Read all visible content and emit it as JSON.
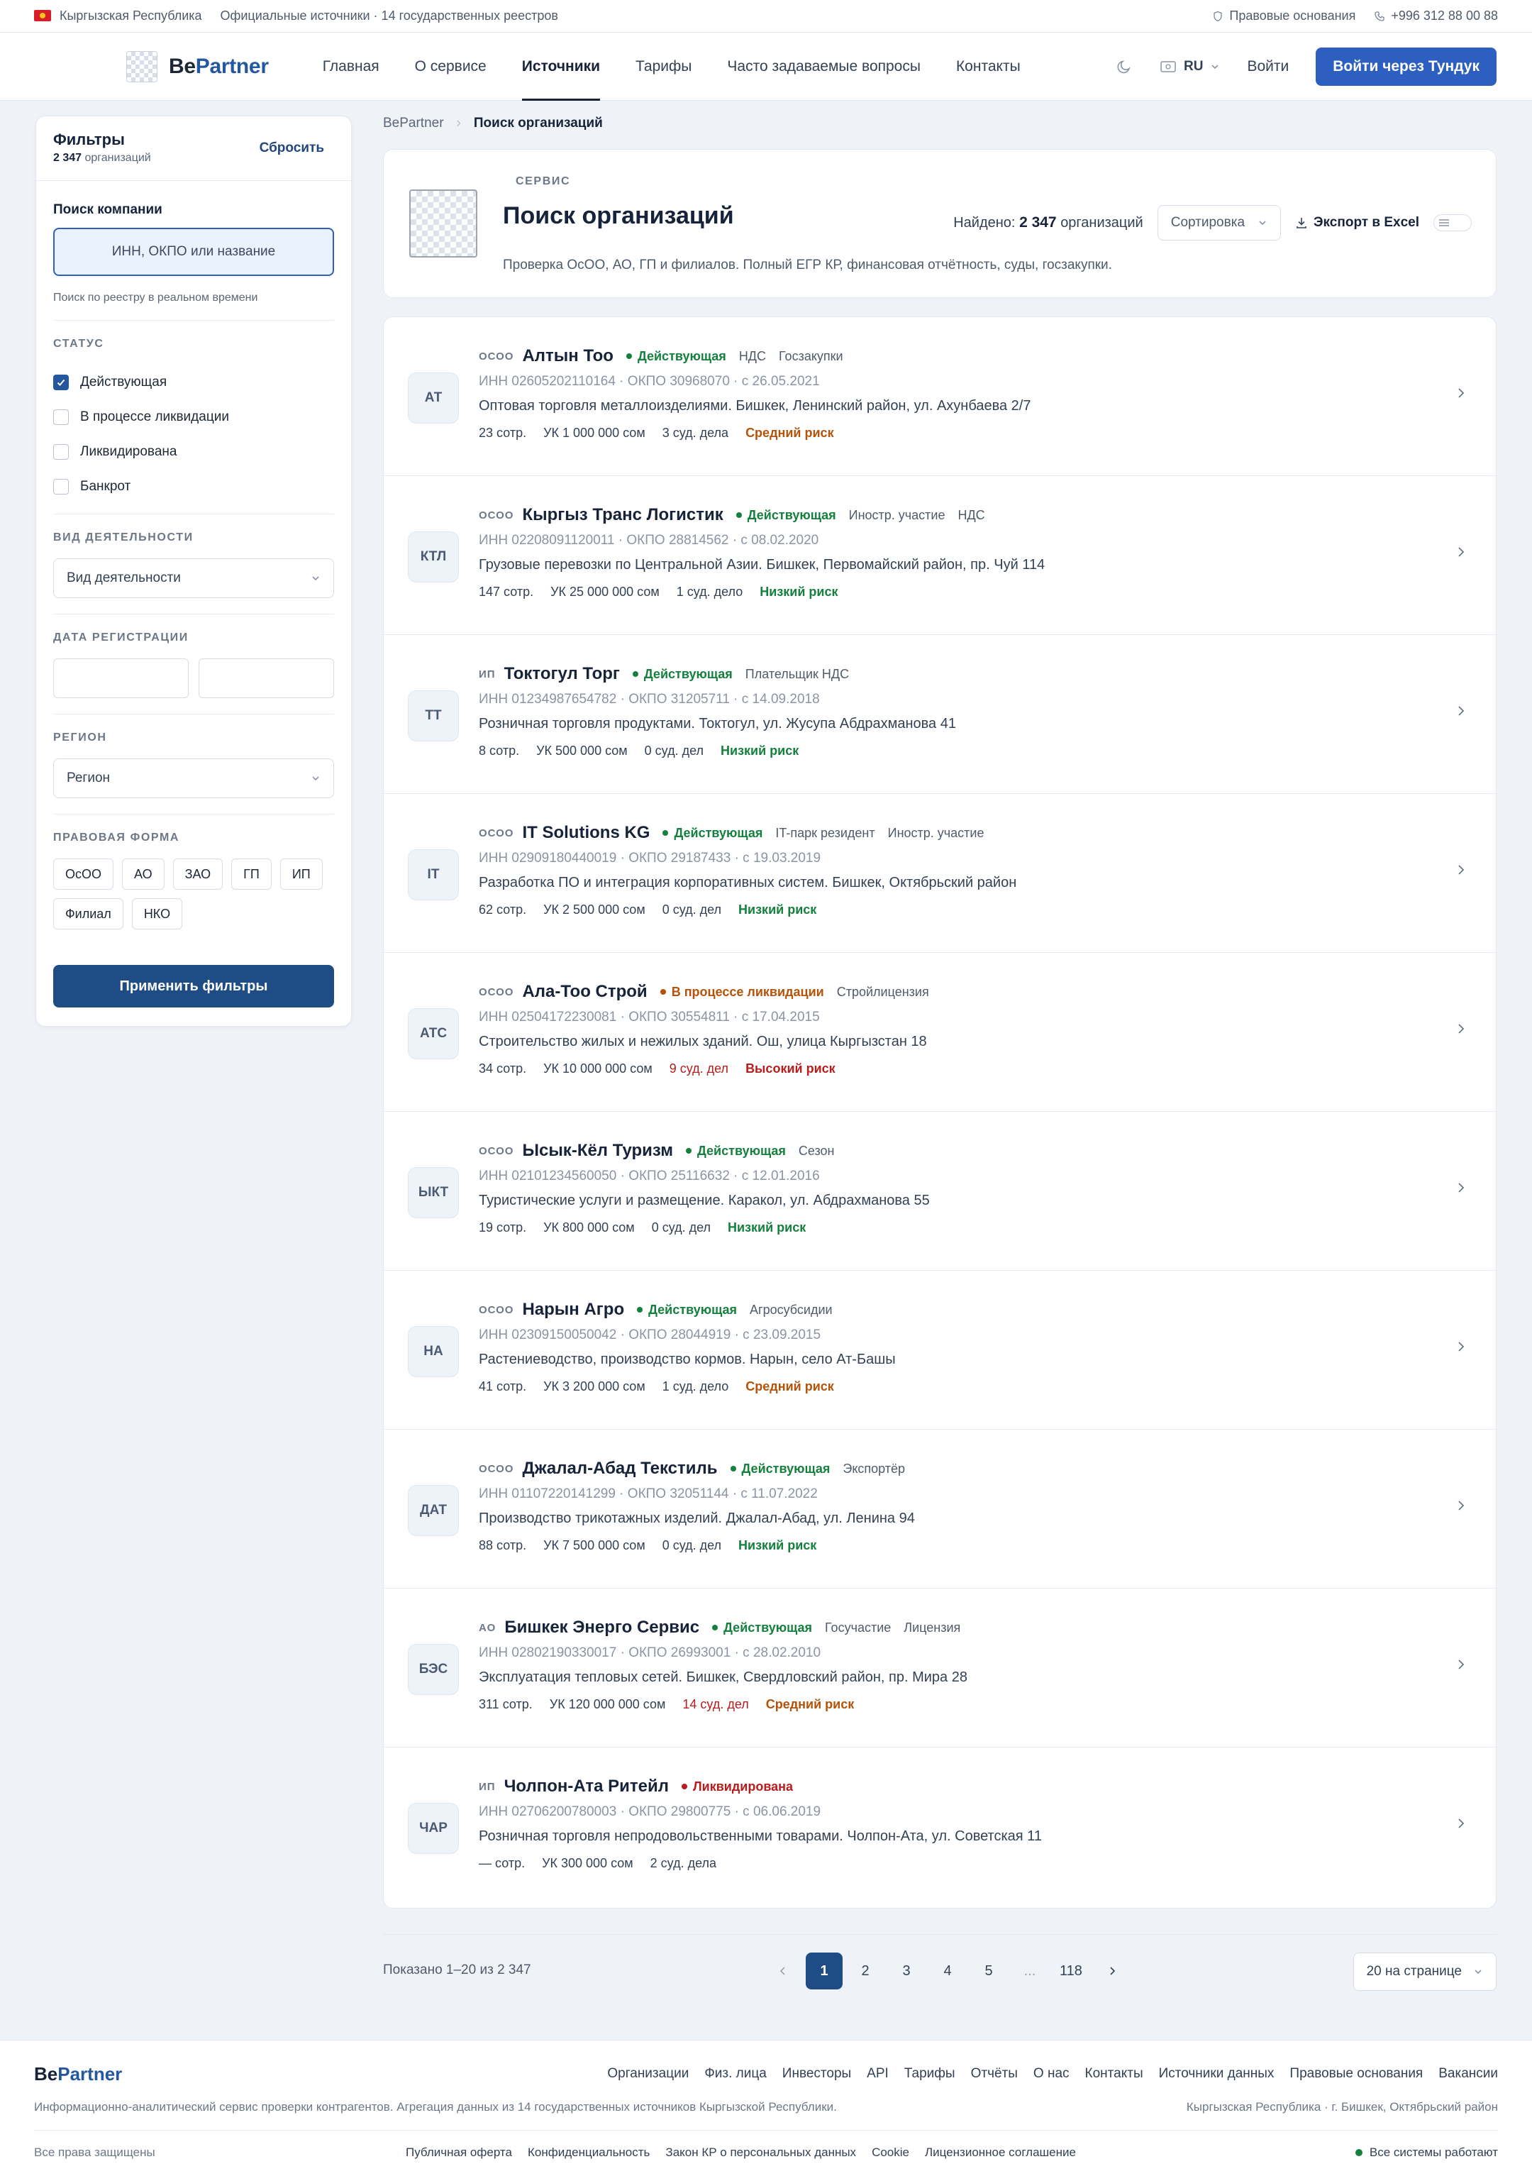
{
  "topbar": {
    "country": "Кыргызская Республика",
    "sources": "Официальные источники · 14 государственных реестров",
    "legal": "Правовые основания",
    "phone": "+996 312 88 00 88"
  },
  "header": {
    "logo_prefix": "Be",
    "logo_suffix": "Partner",
    "nav": [
      "Главная",
      "О сервисе",
      "Источники",
      "Тарифы",
      "Часто задаваемые вопросы",
      "Контакты"
    ],
    "active_nav": "Источники",
    "lang": "RU",
    "login": "Войти",
    "cta": "Войти через Тундук"
  },
  "sidebar": {
    "title": "Фильтры",
    "count": "2 347",
    "count_label": "организаций",
    "reset": "Сбросить",
    "search_label": "Поиск компании",
    "search_placeholder": "ИНН, ОКПО или название",
    "search_hint": "Поиск по реестру в реальном времени",
    "status_title": "СТАТУС",
    "statuses": [
      {
        "label": "Действующая",
        "checked": true
      },
      {
        "label": "В процессе ликвидации",
        "checked": false
      },
      {
        "label": "Ликвидирована",
        "checked": false
      },
      {
        "label": "Банкрот",
        "checked": false
      }
    ],
    "activity_title": "ВИД ДЕЯТЕЛЬНОСТИ",
    "activity_placeholder": "Вид деятельности",
    "date_title": "ДАТА РЕГИСТРАЦИИ",
    "region_title": "РЕГИОН",
    "region_placeholder": "Регион",
    "legal_title": "ПРАВОВАЯ ФОРМА",
    "legal_forms": [
      "ОсОО",
      "АО",
      "ЗАО",
      "ГП",
      "ИП",
      "Филиал",
      "НКО"
    ],
    "apply": "Применить фильтры"
  },
  "breadcrumb": {
    "root": "BePartner",
    "current": "Поиск организаций"
  },
  "hero": {
    "kicker": "СЕРВИС",
    "title": "Поиск организаций",
    "description": "Проверка ОсОО, АО, ГП и филиалов. Полный ЕГР КР, финансовая отчётность, суды, госзакупки.",
    "found_label": "Найдено:",
    "found_count": "2 347",
    "found_suffix": "организаций",
    "sort": "Сортировка",
    "export": "Экспорт в Excel"
  },
  "results": [
    {
      "initials": "АТ",
      "form": "ОСОО",
      "name": "Алтын Тоо",
      "status": "Действующая",
      "status_color": "#15803d",
      "tags": [
        "НДС",
        "Госзакупки"
      ],
      "meta": "ИНН 02605202110164 · ОКПО 30968070 · с 26.05.2021",
      "desc": "Оптовая торговля металлоизделиями. Бишкек, Ленинский район, ул. Ахунбаева 2/7",
      "employees": "23 сотр.",
      "capital": "УК 1 000 000 сом",
      "cases": "3 суд. дела",
      "cases_color": "#334155",
      "risk": "Средний риск",
      "risk_color": "#b45309"
    },
    {
      "initials": "КТЛ",
      "form": "ОСОО",
      "name": "Кыргыз Транс Логистик",
      "status": "Действующая",
      "status_color": "#15803d",
      "tags": [
        "Иностр. участие",
        "НДС"
      ],
      "meta": "ИНН 02208091120011 · ОКПО 28814562 · с 08.02.2020",
      "desc": "Грузовые перевозки по Центральной Азии. Бишкек, Первомайский район, пр. Чуй 114",
      "employees": "147 сотр.",
      "capital": "УК 25 000 000 сом",
      "cases": "1 суд. дело",
      "cases_color": "#334155",
      "risk": "Низкий риск",
      "risk_color": "#15803d"
    },
    {
      "initials": "ТТ",
      "form": "ИП",
      "name": "Токтогул Торг",
      "status": "Действующая",
      "status_color": "#15803d",
      "tags": [
        "Плательщик НДС"
      ],
      "meta": "ИНН 01234987654782 · ОКПО 31205711 · с 14.09.2018",
      "desc": "Розничная торговля продуктами. Токтогул, ул. Жусупа Абдрахманова 41",
      "employees": "8 сотр.",
      "capital": "УК 500 000 сом",
      "cases": "0 суд. дел",
      "cases_color": "#334155",
      "risk": "Низкий риск",
      "risk_color": "#15803d"
    },
    {
      "initials": "IT",
      "form": "ОСОО",
      "name": "IT Solutions KG",
      "status": "Действующая",
      "status_color": "#15803d",
      "tags": [
        "IT-парк резидент",
        "Иностр. участие"
      ],
      "meta": "ИНН 02909180440019 · ОКПО 29187433 · с 19.03.2019",
      "desc": "Разработка ПО и интеграция корпоративных систем. Бишкек, Октябрьский район",
      "employees": "62 сотр.",
      "capital": "УК 2 500 000 сом",
      "cases": "0 суд. дел",
      "cases_color": "#334155",
      "risk": "Низкий риск",
      "risk_color": "#15803d"
    },
    {
      "initials": "АТС",
      "form": "ОСОО",
      "name": "Ала-Тоо Строй",
      "status": "В процессе ликвидации",
      "status_color": "#b45309",
      "tags": [
        "Стройлицензия"
      ],
      "meta": "ИНН 02504172230081 · ОКПО 30554811 · с 17.04.2015",
      "desc": "Строительство жилых и нежилых зданий. Ош, улица Кыргызстан 18",
      "employees": "34 сотр.",
      "capital": "УК 10 000 000 сом",
      "cases": "9 суд. дел",
      "cases_color": "#b91c1c",
      "risk": "Высокий риск",
      "risk_color": "#b91c1c"
    },
    {
      "initials": "ЫКТ",
      "form": "ОСОО",
      "name": "Ысык-Кёл Туризм",
      "status": "Действующая",
      "status_color": "#15803d",
      "tags": [
        "Сезон"
      ],
      "meta": "ИНН 02101234560050 · ОКПО 25116632 · с 12.01.2016",
      "desc": "Туристические услуги и размещение. Каракол, ул. Абдрахманова 55",
      "employees": "19 сотр.",
      "capital": "УК 800 000 сом",
      "cases": "0 суд. дел",
      "cases_color": "#334155",
      "risk": "Низкий риск",
      "risk_color": "#15803d"
    },
    {
      "initials": "НА",
      "form": "ОСОО",
      "name": "Нарын Агро",
      "status": "Действующая",
      "status_color": "#15803d",
      "tags": [
        "Агросубсидии"
      ],
      "meta": "ИНН 02309150050042 · ОКПО 28044919 · с 23.09.2015",
      "desc": "Растениеводство, производство кормов. Нарын, село Ат-Башы",
      "employees": "41 сотр.",
      "capital": "УК 3 200 000 сом",
      "cases": "1 суд. дело",
      "cases_color": "#334155",
      "risk": "Средний риск",
      "risk_color": "#b45309"
    },
    {
      "initials": "ДАТ",
      "form": "ОСОО",
      "name": "Джалал-Абад Текстиль",
      "status": "Действующая",
      "status_color": "#15803d",
      "tags": [
        "Экспортёр"
      ],
      "meta": "ИНН 01107220141299 · ОКПО 32051144 · с 11.07.2022",
      "desc": "Производство трикотажных изделий. Джалал-Абад, ул. Ленина 94",
      "employees": "88 сотр.",
      "capital": "УК 7 500 000 сом",
      "cases": "0 суд. дел",
      "cases_color": "#334155",
      "risk": "Низкий риск",
      "risk_color": "#15803d"
    },
    {
      "initials": "БЭС",
      "form": "АО",
      "name": "Бишкек Энерго Сервис",
      "status": "Действующая",
      "status_color": "#15803d",
      "tags": [
        "Госучастие",
        "Лицензия"
      ],
      "meta": "ИНН 02802190330017 · ОКПО 26993001 · с 28.02.2010",
      "desc": "Эксплуатация тепловых сетей. Бишкек, Свердловский район, пр. Мира 28",
      "employees": "311 сотр.",
      "capital": "УК 120 000 000 сом",
      "cases": "14 суд. дел",
      "cases_color": "#b91c1c",
      "risk": "Средний риск",
      "risk_color": "#b45309"
    },
    {
      "initials": "ЧАР",
      "form": "ИП",
      "name": "Чолпон-Ата Ритейл",
      "status": "Ликвидирована",
      "status_color": "#b91c1c",
      "tags": [],
      "meta": "ИНН 02706200780003 · ОКПО 29800775 · с 06.06.2019",
      "desc": "Розничная торговля непродовольственными товарами. Чолпон-Ата, ул. Советская 11",
      "employees": "— сотр.",
      "capital": "УК 300 000 сом",
      "cases": "2 суд. дела",
      "cases_color": "#334155",
      "risk": "",
      "risk_color": "#334155"
    }
  ],
  "pagination": {
    "shown": "Показано 1–20 из 2 347",
    "pages": [
      "1",
      "2",
      "3",
      "4",
      "5",
      "...",
      "118"
    ],
    "active": "1",
    "per_page": "20 на странице"
  },
  "footer": {
    "logo_prefix": "Be",
    "logo_suffix": "Partner",
    "links": [
      "Организации",
      "Физ. лица",
      "Инвесторы",
      "API",
      "Тарифы",
      "Отчёты",
      "О нас",
      "Контакты",
      "Источники данных",
      "Правовые основания",
      "Вакансии"
    ],
    "description": "Информационно-аналитический сервис проверки контрагентов. Агрегация данных из 14 государственных источников Кыргызской Республики.",
    "address": "Кыргызская Республика · г. Бишкек, Октябрьский район",
    "rights": "Все права защищены",
    "legal_links": [
      "Публичная оферта",
      "Конфиденциальность",
      "Закон КР о персональных данных",
      "Cookie",
      "Лицензионное соглашение"
    ],
    "system_status": "Все системы работают"
  }
}
